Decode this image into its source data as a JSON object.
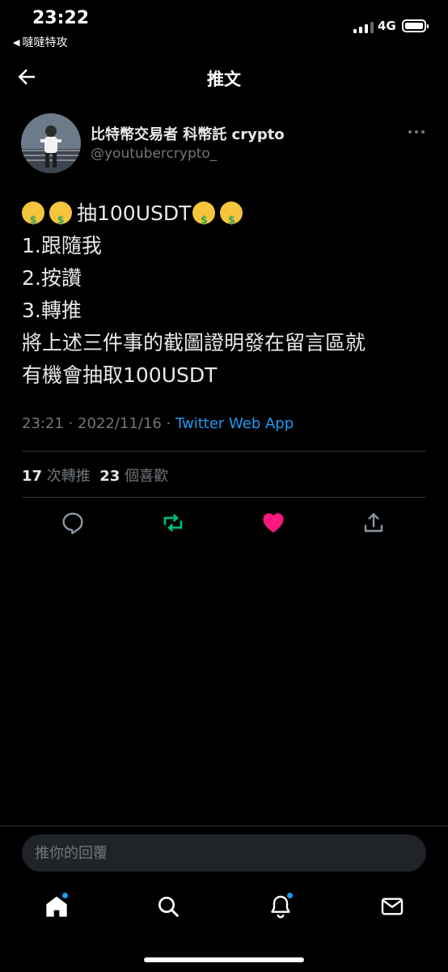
{
  "status_bar": {
    "time": "23:22",
    "back_app": "噠噠特攻",
    "network": "4G"
  },
  "nav": {
    "title": "推文"
  },
  "tweet": {
    "author_name": "比特幣交易者 科幣託 crypto",
    "author_handle": "@youtubercrypto_",
    "line1_text": "抽100USDT",
    "line2": "1.跟隨我",
    "line3": "2.按讚",
    "line4": "3.轉推",
    "line5": "將上述三件事的截圖證明發在留言區就",
    "line6": "有機會抽取100USDT",
    "time": "23:21",
    "date": "2022/11/16",
    "source": "Twitter Web App",
    "separator": " · ",
    "emoji_icon": "money-mouth-face-icon"
  },
  "stats": {
    "retweets_count": "17",
    "retweets_label": "次轉推",
    "likes_count": "23",
    "likes_label": "個喜歡"
  },
  "actions": {
    "reply_icon": "reply-icon",
    "retweet_icon": "retweet-icon",
    "like_icon": "heart-icon",
    "share_icon": "share-icon",
    "retweet_color": "#00ba7c",
    "like_color": "#f91880"
  },
  "reply_box": {
    "placeholder": "推你的回覆"
  },
  "tab_bar": {
    "tabs": [
      "home",
      "search",
      "notifications",
      "messages"
    ],
    "accent": "#1d9bf0"
  }
}
